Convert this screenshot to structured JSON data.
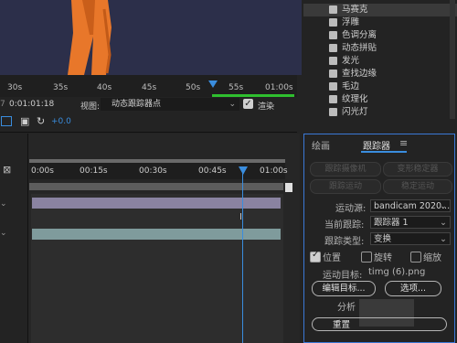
{
  "viewer": {
    "ruler_ticks": [
      "30s",
      "35s",
      "40s",
      "45s",
      "50s",
      "55s",
      "01:00s"
    ],
    "timecode": "0:01:01:18",
    "view_label": "视图:",
    "view_value": "动态跟踪器点",
    "render_label": "渲染",
    "offset_value": "+0.0"
  },
  "effects": {
    "items": [
      {
        "label": "马赛克",
        "selected": true
      },
      {
        "label": "浮雕",
        "selected": false
      },
      {
        "label": "色调分离",
        "selected": false
      },
      {
        "label": "动态拼贴",
        "selected": false
      },
      {
        "label": "发光",
        "selected": false
      },
      {
        "label": "查找边缘",
        "selected": false
      },
      {
        "label": "毛边",
        "selected": false
      },
      {
        "label": "纹理化",
        "selected": false
      },
      {
        "label": "闪光灯",
        "selected": false
      }
    ]
  },
  "timeline": {
    "ruler_ticks": [
      "0:00s",
      "00:15s",
      "00:30s",
      "00:45s",
      "01:00s"
    ]
  },
  "tracker": {
    "tabs": [
      "绘画",
      "跟踪器"
    ],
    "menu_icon": "hamburger-menu-icon",
    "buttons_row1": [
      "跟踪摄像机",
      "变形稳定器"
    ],
    "buttons_row2": [
      "跟踪运动",
      "稳定运动"
    ],
    "motion_source_label": "运动源:",
    "motion_source_value": "bandicam 2020...",
    "current_track_label": "当前跟踪:",
    "current_track_value": "跟踪器 1",
    "track_type_label": "跟踪类型:",
    "track_type_value": "变换",
    "position_label": "位置",
    "position_checked": true,
    "rotation_label": "旋转",
    "rotation_checked": false,
    "scale_label": "缩放",
    "scale_checked": false,
    "motion_target_label": "运动目标:",
    "motion_target_value": "timg (6).png",
    "edit_target_button": "编辑目标...",
    "options_button": "选项...",
    "analyze_label": "分析",
    "reset_button": "重置"
  }
}
